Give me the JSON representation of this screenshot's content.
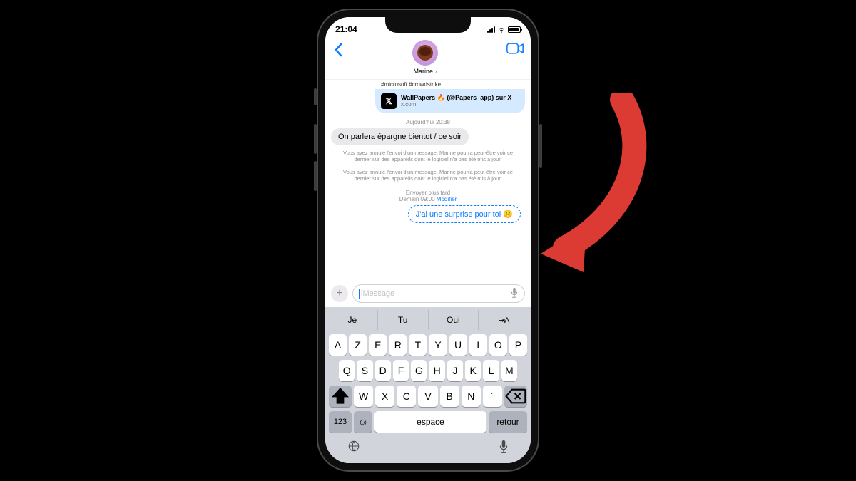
{
  "status": {
    "time": "21:04"
  },
  "header": {
    "contact_name": "Marine"
  },
  "chat": {
    "cutoff_text": "#microsoft #crowdstrike",
    "link_card": {
      "title": "WallPapers 🔥 (@Papers_app) sur X",
      "subtitle": "x.com"
    },
    "timestamp": "Aujourd'hui 20:38",
    "incoming_msg": "On parlera épargne bientot / ce soir",
    "system_msg_1": "Vous avez annulé l'envoi d'un message. Marine pourra peut-être voir ce dernier sur des appareils dont le logiciel n'a pas été mis à jour.",
    "system_msg_2": "Vous avez annulé l'envoi d'un message. Marine pourra peut-être voir ce dernier sur des appareils dont le logiciel n'a pas été mis à jour.",
    "send_later_label": "Envoyer plus tard",
    "send_later_time": "Demain 09:00",
    "send_later_edit": "Modifier",
    "scheduled_msg": "J'ai une surprise pour toi 🤫"
  },
  "compose": {
    "placeholder": "iMessage"
  },
  "keyboard": {
    "suggestions": [
      "Je",
      "Tu",
      "Oui"
    ],
    "row1": [
      "A",
      "Z",
      "E",
      "R",
      "T",
      "Y",
      "U",
      "I",
      "O",
      "P"
    ],
    "row2": [
      "Q",
      "S",
      "D",
      "F",
      "G",
      "H",
      "J",
      "K",
      "L",
      "M"
    ],
    "row3": [
      "W",
      "X",
      "C",
      "V",
      "B",
      "N",
      "´"
    ],
    "key_123": "123",
    "key_space": "espace",
    "key_return": "retour"
  },
  "annotation": {
    "arrow_color": "#dc3b33"
  }
}
